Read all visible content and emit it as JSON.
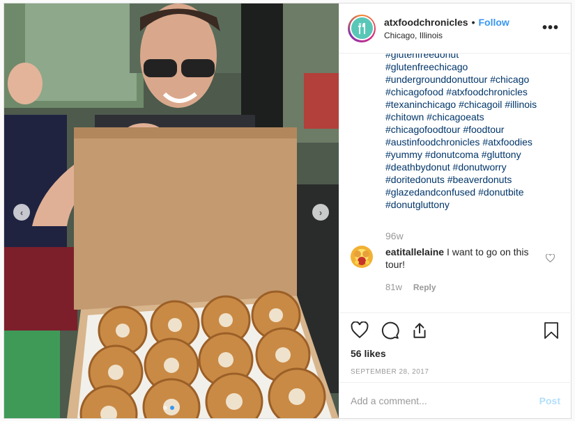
{
  "header": {
    "username": "atxfoodchronicles",
    "bullet": "•",
    "follow_label": "Follow",
    "location": "Chicago, Illinois",
    "more_label": "•••",
    "avatar_icon": "fork-knife-icon"
  },
  "caption": {
    "hashtag_lines": [
      [
        "#glutenfreedonut"
      ],
      [
        "#glutenfreechicago"
      ],
      [
        "#undergrounddonuttour",
        "#chicago"
      ],
      [
        "#chicagofood",
        "#atxfoodchronicles"
      ],
      [
        "#texaninchicago",
        "#chicagoil",
        "#illinois"
      ],
      [
        "#chitown",
        "#chicagoeats"
      ],
      [
        "#chicagofoodtour",
        "#foodtour"
      ],
      [
        "#austinfoodchronicles",
        "#atxfoodies"
      ],
      [
        "#yummy",
        "#donutcoma",
        "#gluttony"
      ],
      [
        "#deathbydonut",
        "#donutworry"
      ],
      [
        "#doritedonuts",
        "#beaverdonuts"
      ],
      [
        "#glazedandconfused",
        "#donutbite"
      ],
      [
        "#donutgluttony"
      ]
    ],
    "time": "96w"
  },
  "comment": {
    "username": "eatitallelaine",
    "text": "I want to go on this tour!",
    "time": "81w",
    "reply_label": "Reply"
  },
  "actions": {
    "like_icon": "heart-icon",
    "comment_icon": "comment-icon",
    "share_icon": "share-icon",
    "save_icon": "bookmark-icon",
    "likes": "56 likes",
    "date": "SEPTEMBER 28, 2017"
  },
  "add_comment": {
    "placeholder": "Add a comment...",
    "post_label": "Post"
  },
  "media": {
    "prev_label": "‹",
    "next_label": "›",
    "slide_count": 2,
    "active_slide": 2
  },
  "colors": {
    "link": "#3897f0",
    "hashtag": "#003569",
    "muted": "#999999",
    "post_disabled": "#b2dffc"
  }
}
